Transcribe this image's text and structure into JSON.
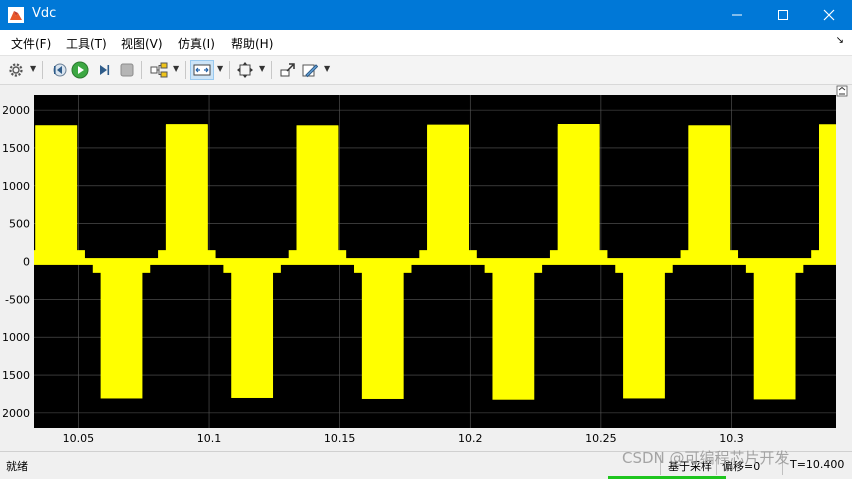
{
  "window": {
    "title": "Vdc"
  },
  "menu": [
    "文件(F)",
    "工具(T)",
    "视图(V)",
    "仿真(I)",
    "帮助(H)"
  ],
  "toolbar_icons": [
    "gear-icon",
    "step-back-icon",
    "run-icon",
    "step-forward-icon",
    "stop-icon",
    "signal-selector-icon",
    "zoom-x-icon",
    "fit-to-view-icon",
    "highlight-block-icon",
    "style-icon"
  ],
  "status": {
    "ready": "就绪",
    "sample_based": "基于采样",
    "offset": "偏移=0",
    "time": "T=10.400"
  },
  "watermark": "CSDN @可编程芯片开发",
  "colors": {
    "title_bg": "#0078d7",
    "plot_bg": "#000000",
    "trace": "#ffff00",
    "grid": "#5a5a5a"
  },
  "chart_data": {
    "type": "line",
    "title": "",
    "xlabel": "",
    "ylabel": "",
    "xlim": [
      10.033,
      10.34
    ],
    "ylim": [
      -2200,
      2200
    ],
    "xticks": [
      "10.05",
      "10.1",
      "10.15",
      "10.2",
      "10.25",
      "10.3"
    ],
    "yticks": [
      "2000",
      "1500",
      "1000",
      "500",
      "0",
      "-500",
      "-1000",
      "-1500",
      "-2000"
    ],
    "grid": true,
    "series": [
      {
        "period": 0.05,
        "positive_pulses": [
          {
            "x": [
              10.0335,
              10.0495
            ],
            "high": 1800,
            "mid_x": [
              10.0335,
              10.037
            ],
            "mid": 150
          },
          {
            "x": [
              10.0835,
              10.0995
            ],
            "high": 1800,
            "mid_x": [
              10.0805,
              10.1025
            ],
            "mid": 150
          }
        ],
        "negative_pulses": [
          {
            "x": [
              10.0585,
              10.0745
            ],
            "low": -1820,
            "mid_x": [
              10.0555,
              10.0775
            ],
            "mid": -150
          }
        ],
        "baseline": 0,
        "noise": 45
      }
    ]
  }
}
